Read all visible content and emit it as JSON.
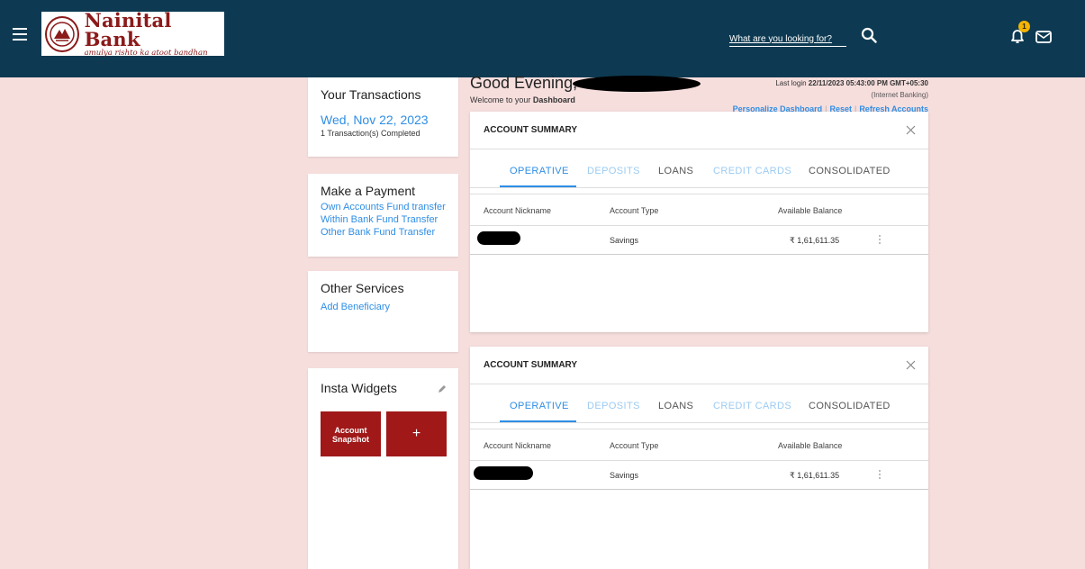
{
  "header": {
    "bank_name": "Nainital Bank",
    "tagline": "amulya rishto ka atoot bandhan",
    "search_placeholder": "What are you looking for?",
    "notification_count": "1"
  },
  "transactions": {
    "title": "Your Transactions",
    "date": "Wed, Nov 22, 2023",
    "summary": "1 Transaction(s) Completed"
  },
  "payment": {
    "title": "Make a Payment",
    "links": [
      "Own Accounts Fund transfer",
      "Within Bank Fund Transfer",
      "Other Bank Fund Transfer"
    ]
  },
  "services": {
    "title": "Other Services",
    "links": [
      "Add Beneficiary"
    ]
  },
  "insta": {
    "title": "Insta Widgets",
    "snapshot_label": "Account Snapshot",
    "add_label": "+"
  },
  "greeting": {
    "text": "Good Evening,",
    "welcome_prefix": "Welcome to your",
    "welcome_bold": "Dashboard",
    "last_login_label": "Last login",
    "last_login_value": "22/11/2023 05:43:00 PM GMT+05:30",
    "channel": "(Internet Banking)",
    "links": [
      "Personalize Dashboard",
      "Reset",
      "Refresh Accounts"
    ]
  },
  "summary": {
    "title": "ACCOUNT SUMMARY",
    "tabs": [
      "OPERATIVE",
      "DEPOSITS",
      "LOANS",
      "CREDIT CARDS",
      "CONSOLIDATED"
    ],
    "columns": [
      "Account Nickname",
      "Account Type",
      "Available Balance"
    ],
    "rows": [
      {
        "type": "Savings",
        "balance": "₹ 1,61,611.35"
      }
    ]
  },
  "colors": {
    "header_bg": "#0d3a52",
    "page_bg": "#f6dedd",
    "accent_link": "#2f8ee5",
    "brand_red": "#a01818",
    "badge": "#f4b400"
  }
}
